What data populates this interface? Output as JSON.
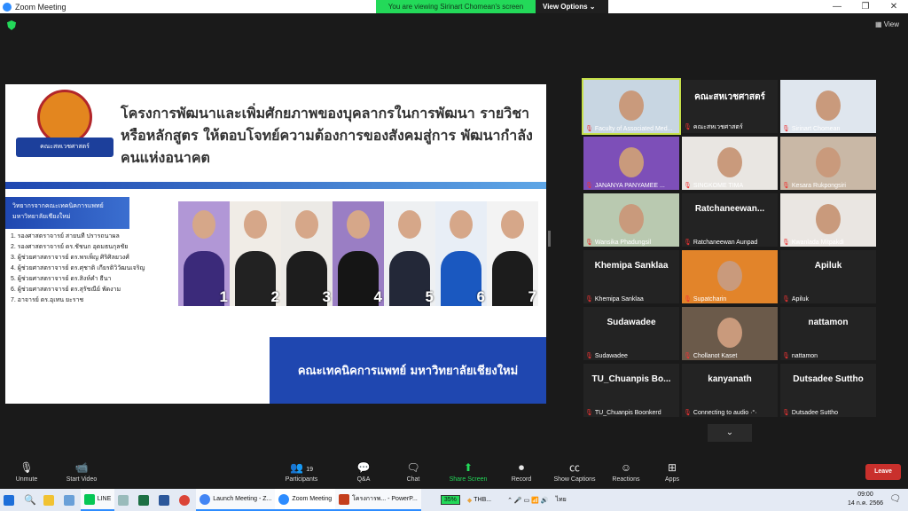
{
  "window": {
    "title": "Zoom Meeting",
    "minimize": "—",
    "maximize": "❐",
    "close": "✕"
  },
  "share_banner": {
    "message": "You are viewing Sirinart Chomean's screen",
    "options": "View Options ⌄"
  },
  "view_button": "▦ View",
  "slide": {
    "logo_text": "คณะสหเวชศาสตร์",
    "heading": "โครงการพัฒนาและเพิ่มศักยภาพของบุคลากรในการพัฒนา รายวิชาหรือหลักสูตร ให้ตอบโจทย์ความต้องการของสังคมสู่การ พัฒนากำลังคนแห่งอนาคต",
    "subhead": "วิทยากรจากคณะเทคนิคการแพทย์ มหาวิทยาลัยเชียงใหม่",
    "speakers": [
      "1. รองศาสตราจารย์ สายนที ปรารถนาผล",
      "2. รองศาสตราจารย์ ดร.ชัชนก อุดมธนกุลชัย",
      "3. ผู้ช่วยศาสตราจารย์ ดร.พรเพ็ญ ศิริศิลยวงศ์",
      "4. ผู้ช่วยศาสตราจารย์ ดร.ศุชาติ เกียรติวิวัฒนเจริญ",
      "5. ผู้ช่วยศาสตราจารย์ ดร.สิงห์คำ ธีนา",
      "6. ผู้ช่วยศาสตราจารย์ ดร.สุรัชณีย์ พัดงาม",
      "7. อาจารย์ ดร.อุเทน ยะราช"
    ],
    "photo_numbers": [
      "1",
      "2",
      "3",
      "4",
      "5",
      "6",
      "7"
    ],
    "footer": "คณะเทคนิคการแพทย์ มหาวิทยาลัยเชียงใหม่"
  },
  "participants": [
    {
      "label": "Faculty of Associated Med...",
      "big": "",
      "video": true
    },
    {
      "label": "คณะสหเวชศาสตร์",
      "big": "คณะสหเวชศาสตร์",
      "video": false
    },
    {
      "label": "Sirinart Chomean",
      "big": "",
      "video": true
    },
    {
      "label": "JANANYA PANYAMEE ...",
      "big": "",
      "video": true
    },
    {
      "label": "SINGKOME TIMA",
      "big": "",
      "video": true
    },
    {
      "label": "Kesara Rukpongsiri",
      "big": "",
      "video": true
    },
    {
      "label": "Wansika Phadungsil",
      "big": "",
      "video": true
    },
    {
      "label": "Ratchaneewan Aunpad",
      "big": "Ratchaneewan...",
      "video": false
    },
    {
      "label": "Kwanlada Mitpakdi",
      "big": "",
      "video": true
    },
    {
      "label": "Khemipa Sanklaa",
      "big": "Khemipa Sanklaa",
      "video": false
    },
    {
      "label": "Supatcharin",
      "big": "",
      "video": true
    },
    {
      "label": "Apiluk",
      "big": "Apiluk",
      "video": false
    },
    {
      "label": "Sudawadee",
      "big": "Sudawadee",
      "video": false
    },
    {
      "label": "Chollanot Kaset",
      "big": "",
      "video": true
    },
    {
      "label": "nattamon",
      "big": "nattamon",
      "video": false
    },
    {
      "label": "TU_Chuanpis Boonkerd",
      "big": "TU_Chuanpis Bo...",
      "video": false
    },
    {
      "label": "Connecting to audio ·°·",
      "big": "kanyanath",
      "video": false
    },
    {
      "label": "Dutsadee Suttho",
      "big": "Dutsadee Suttho",
      "video": false
    }
  ],
  "gallery_down": "⌄",
  "toolbar": {
    "unmute": "Unmute",
    "start_video": "Start Video",
    "participants": "Participants",
    "participants_count": "19",
    "qa": "Q&A",
    "chat": "Chat",
    "share_screen": "Share Screen",
    "record": "Record",
    "show_captions": "Show Captions",
    "reactions": "Reactions",
    "apps": "Apps",
    "leave": "Leave"
  },
  "taskbar": {
    "line": "LINE",
    "launch": "Launch Meeting - Z...",
    "zoom": "Zoom Meeting",
    "ppt": "โครงการพ... - PowerP...",
    "battery": "35%",
    "currency": "THB...",
    "lang": "ไทย",
    "time": "09:00",
    "date": "14 ก.ค. 2566"
  }
}
